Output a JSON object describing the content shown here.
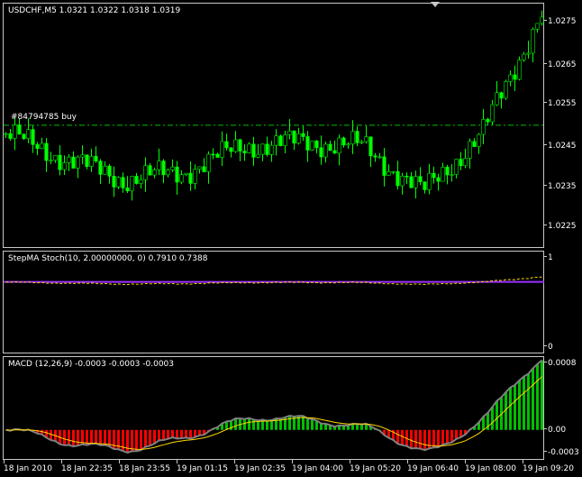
{
  "window": {
    "symbol_title": "USDCHF,M5  1.0321 1.0322 1.0318 1.0319"
  },
  "main_chart": {
    "order_label": "#84794785 buy",
    "order_price": 1.0251,
    "y_labels": [
      "1.0275",
      "1.0265",
      "1.0255",
      "1.0245",
      "1.0235",
      "1.0225"
    ],
    "ylim": [
      1.02215,
      1.028
    ],
    "colors": {
      "bull": "#00ff00",
      "bear": "#00ff00",
      "order_line": "#00c000"
    }
  },
  "stoch_indicator": {
    "title": "StepMA Stoch(10, 2.00000000, 0) 0.7910 0.7388",
    "y_labels": [
      "1",
      "0"
    ],
    "ylim": [
      0,
      1
    ],
    "level": 0.7388,
    "colors": {
      "level_line": "#9b30ff",
      "signal": "#ffd700"
    }
  },
  "macd_indicator": {
    "title": "MACD (12,26,9) -0.0003 -0.0003 -0.0003",
    "y_labels": [
      "0.0008",
      "0.00",
      "-0.0003"
    ],
    "ylim": [
      -0.00036,
      0.00085
    ],
    "colors": {
      "hist_pos": "#00c000",
      "hist_neg": "#ff0000",
      "macd_line": "#808080",
      "signal_line": "#ffd700"
    }
  },
  "x_axis": {
    "labels": [
      "18 Jan 2010",
      "18 Jan 22:35",
      "18 Jan 23:55",
      "19 Jan 01:15",
      "19 Jan 02:35",
      "19 Jan 04:00",
      "19 Jan 05:20",
      "19 Jan 06:40",
      "19 Jan 08:00",
      "19 Jan 09:20"
    ]
  },
  "chart_data": {
    "type": "line",
    "title": "USDCHF,M5",
    "x": [
      "18 Jan 2010",
      "18 Jan 22:35",
      "18 Jan 23:55",
      "19 Jan 01:15",
      "19 Jan 02:35",
      "19 Jan 04:00",
      "19 Jan 05:20",
      "19 Jan 06:40",
      "19 Jan 08:00",
      "19 Jan 09:20"
    ],
    "series": [
      {
        "name": "USDCHF",
        "values": [
          1.0249,
          1.0243,
          1.0238,
          1.024,
          1.0246,
          1.0247,
          1.0246,
          1.0235,
          1.0249,
          1.0278
        ]
      }
    ],
    "ylim": [
      1.0222,
      1.028
    ]
  }
}
